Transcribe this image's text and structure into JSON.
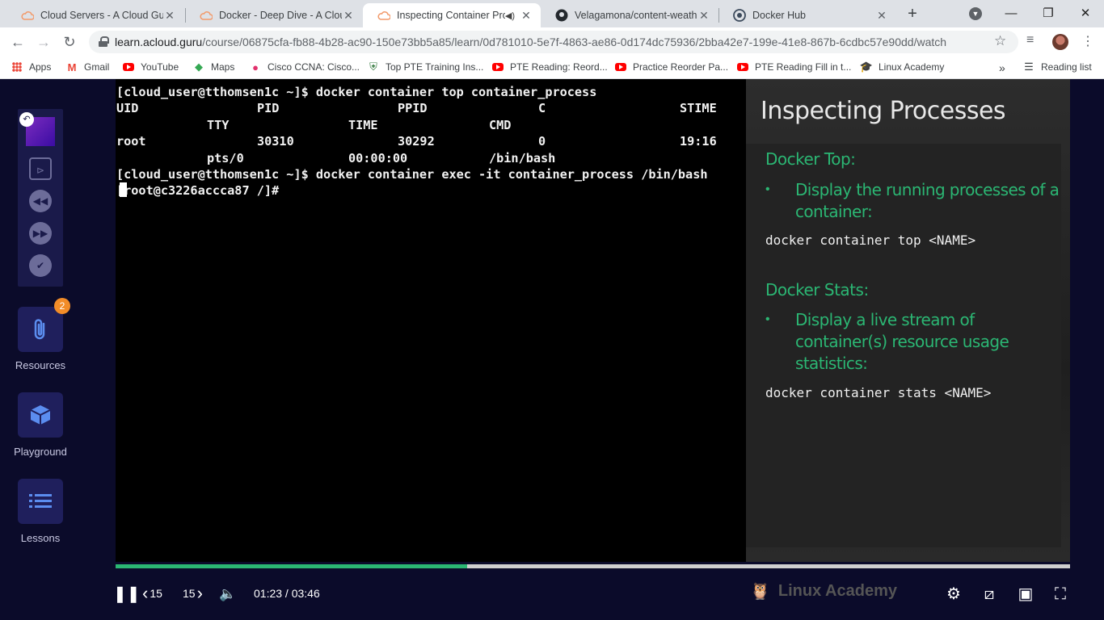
{
  "tabs": [
    {
      "title": "Cloud Servers - A Cloud Guru",
      "icon": "cloud-icon",
      "active": false
    },
    {
      "title": "Docker - Deep Dive - A Cloud",
      "icon": "cloud-icon",
      "active": false
    },
    {
      "title": "Inspecting Container Pro",
      "icon": "cloud-icon",
      "active": true
    },
    {
      "title": "Velagamona/content-weathe",
      "icon": "github-icon",
      "active": false
    },
    {
      "title": "Docker Hub",
      "icon": "docker-icon",
      "active": false
    }
  ],
  "address": {
    "domain": "learn.acloud.guru",
    "path": "/course/06875cfa-fb88-4b28-ac90-150e73bb5a85/learn/0d781010-5e7f-4863-ae86-0d174dc75936/2bba42e7-199e-41e8-867b-6cdbc57e90dd/watch"
  },
  "bookmarks": [
    {
      "label": "Apps",
      "icon": "apps-grid-icon"
    },
    {
      "label": "Gmail",
      "icon": "gmail-icon"
    },
    {
      "label": "YouTube",
      "icon": "youtube-icon"
    },
    {
      "label": "Maps",
      "icon": "maps-icon"
    },
    {
      "label": "Cisco CCNA: Cisco...",
      "icon": "cisco-icon"
    },
    {
      "label": "Top PTE Training Ins...",
      "icon": "pte-icon"
    },
    {
      "label": "PTE Reading: Reord...",
      "icon": "youtube-icon"
    },
    {
      "label": "Practice Reorder Pa...",
      "icon": "youtube-icon"
    },
    {
      "label": "PTE Reading Fill in t...",
      "icon": "youtube-icon"
    },
    {
      "label": "Linux Academy",
      "icon": "linux-academy-icon"
    }
  ],
  "bookmarks_overflow": "»",
  "reading_list": "Reading list",
  "sidebar": {
    "resources_label": "Resources",
    "resources_badge": "2",
    "playground_label": "Playground",
    "lessons_label": "Lessons"
  },
  "terminal": {
    "lines": [
      {
        "cols": [
          "[cloud_user@tthomsen1c ~]$ docker container top container_process"
        ]
      },
      {
        "cols": [
          "UID",
          "PID",
          "PPID",
          "C",
          "STIME"
        ]
      },
      {
        "cols": [
          "TTY",
          "TIME",
          "CMD"
        ]
      },
      {
        "cols": [
          "root",
          "30310",
          "30292",
          "0",
          "19:16"
        ]
      },
      {
        "cols": [
          "pts/0",
          "00:00:00",
          "/bin/bash"
        ]
      },
      {
        "cols": [
          "[cloud_user@tthomsen1c ~]$ docker container exec -it container_process /bin/bash"
        ]
      },
      {
        "cols": [
          "[root@c3226accca87 /]#"
        ]
      }
    ]
  },
  "slide": {
    "title": "Inspecting Processes",
    "sections": [
      {
        "heading": "Docker Top:",
        "bullet": "Display the running processes of a container:",
        "code": "docker container top <NAME>"
      },
      {
        "heading": "Docker Stats:",
        "bullet": "Display a live stream of container(s) resource usage statistics:",
        "code": "docker container stats <NAME>"
      }
    ],
    "watermark": "Linux Academy"
  },
  "player": {
    "progress": 0.368,
    "rewind_label": "15",
    "forward_label": "15",
    "current_time": "01:23",
    "duration": "03:46",
    "time_display": "01:23 / 03:46"
  },
  "colors": {
    "accent": "#2bb673",
    "sidebar_bg": "#0b0b2a",
    "badge": "#f28c28"
  }
}
